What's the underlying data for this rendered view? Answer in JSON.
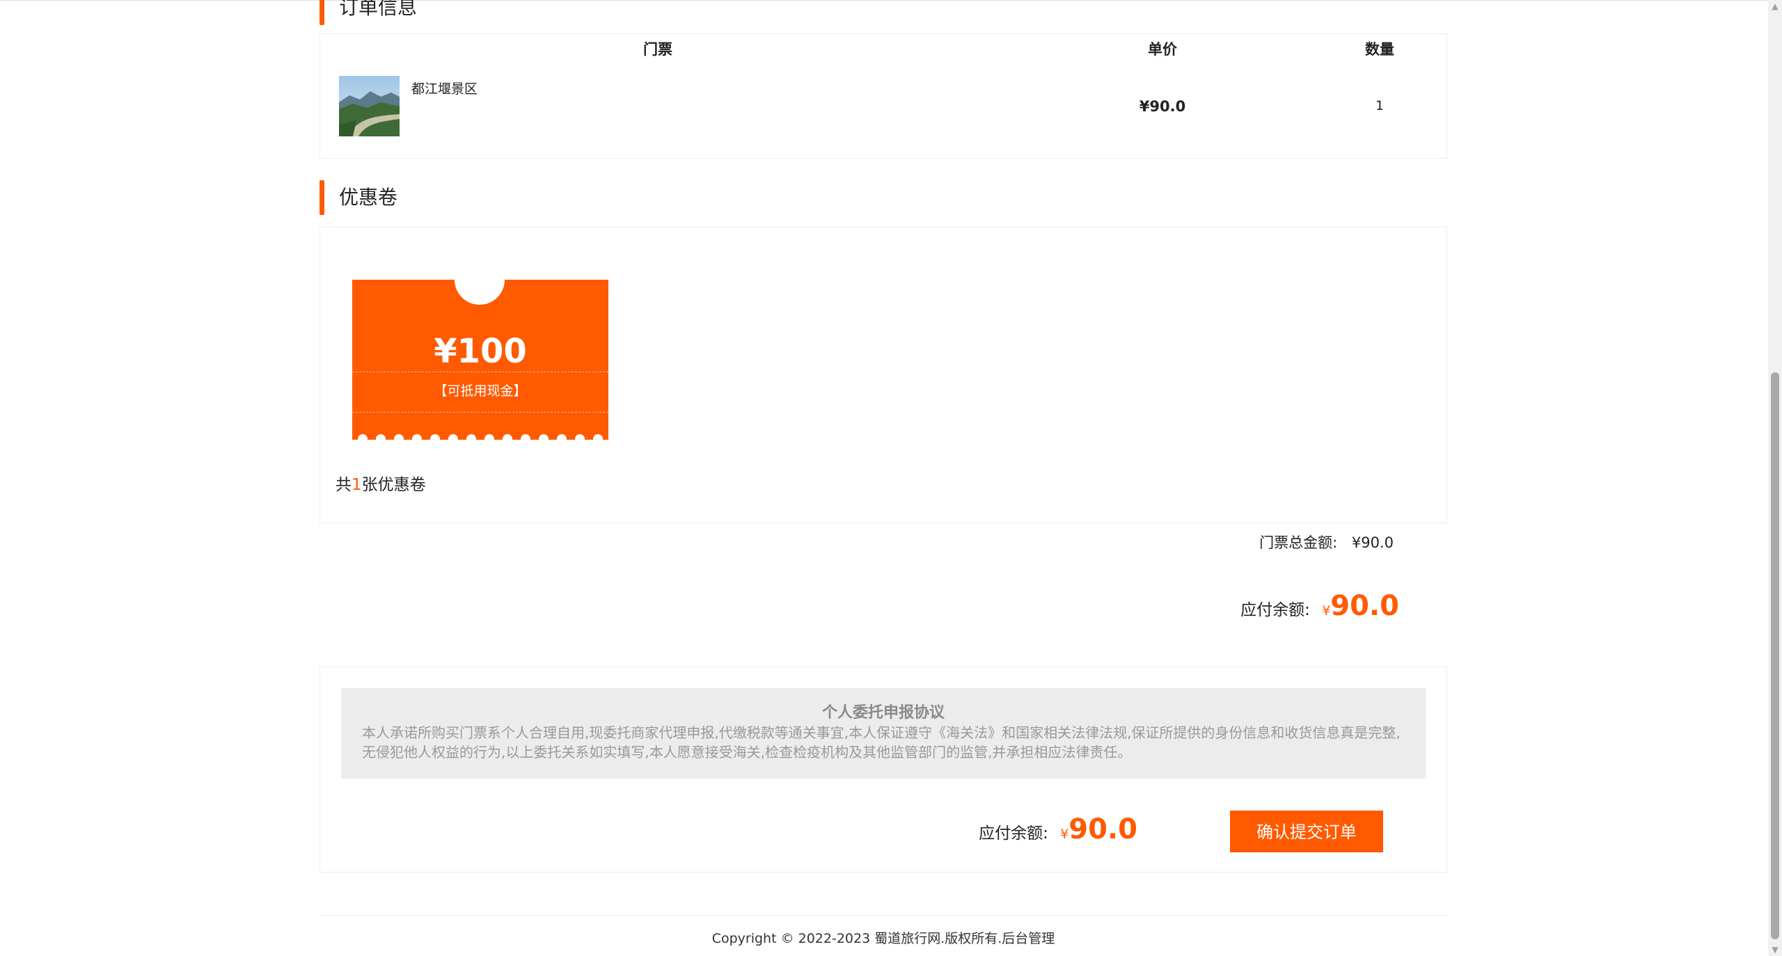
{
  "order_section": {
    "title": "订单信息",
    "headers": {
      "ticket": "门票",
      "unit_price": "单价",
      "quantity": "数量"
    },
    "row": {
      "name": "都江堰景区",
      "price": "¥90.0",
      "quantity": "1"
    }
  },
  "coupon_section": {
    "title": "优惠卷",
    "coupon": {
      "amount": "¥100",
      "note": "【可抵用现金】"
    },
    "count_prefix": "共",
    "count": "1",
    "count_suffix": "张优惠卷"
  },
  "summary": {
    "total_label": "门票总金额:",
    "total_value": "¥90.0",
    "due_label": "应付余额:",
    "due_currency": "¥",
    "due_value": "90.0"
  },
  "agreement": {
    "title": "个人委托申报协议",
    "text": "本人承诺所购买门票系个人合理自用,现委托商家代理申报,代缴税款等通关事宜,本人保证遵守《海关法》和国家相关法律法规,保证所提供的身份信息和收货信息真是完整,无侵犯他人权益的行为,以上委托关系如实填写,本人愿意接受海关,检查检疫机构及其他监管部门的监管,并承担相应法律责任。",
    "due_label": "应付余额:",
    "due_currency": "¥",
    "due_value": "90.0",
    "submit_label": "确认提交订单"
  },
  "footer": {
    "text": "Copyright © 2022-2023 蜀道旅行网.版权所有.后台管理"
  },
  "colors": {
    "accent": "#ff5a00"
  }
}
